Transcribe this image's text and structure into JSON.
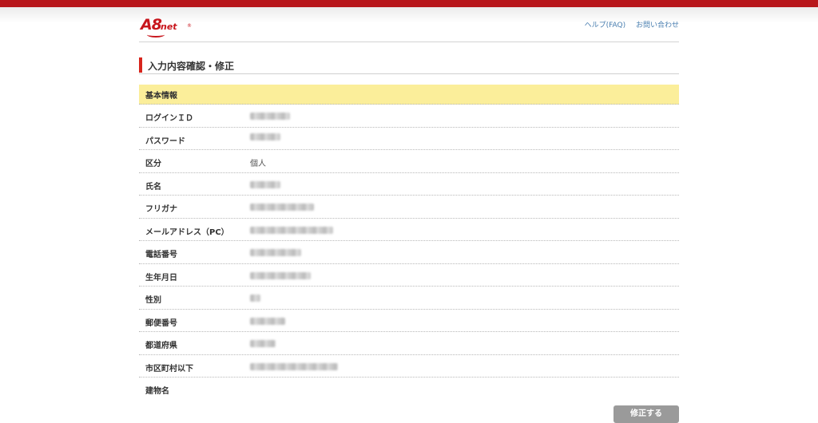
{
  "header": {
    "logo_text": "A8",
    "logo_suffix": "net",
    "links": [
      "ヘルプ(FAQ)",
      "お問い合わせ"
    ]
  },
  "page_title": "入力内容確認・修正",
  "section_title": "基本情報",
  "rows": [
    {
      "label": "ログインＩＤ",
      "value": "",
      "blurred": true
    },
    {
      "label": "パスワード",
      "value": "",
      "blurred": true
    },
    {
      "label": "区分",
      "value": "個人",
      "blurred": false
    },
    {
      "label": "氏名",
      "value": "",
      "blurred": true
    },
    {
      "label": "フリガナ",
      "value": "",
      "blurred": true
    },
    {
      "label": "メールアドレス（PC）",
      "value": "",
      "blurred": true
    },
    {
      "label": "電話番号",
      "value": "",
      "blurred": true
    },
    {
      "label": "生年月日",
      "value": "",
      "blurred": true
    },
    {
      "label": "性別",
      "value": "",
      "blurred": true
    },
    {
      "label": "郵便番号",
      "value": "",
      "blurred": true
    },
    {
      "label": "都道府県",
      "value": "",
      "blurred": true
    },
    {
      "label": "市区町村以下",
      "value": "",
      "blurred": true
    },
    {
      "label": "建物名",
      "value": "",
      "blurred": false
    }
  ],
  "submit_label": "修正する",
  "colors": {
    "brand_red": "#c8161d",
    "section_bg": "#fbee9a",
    "button_gray": "#9a9a9a"
  }
}
